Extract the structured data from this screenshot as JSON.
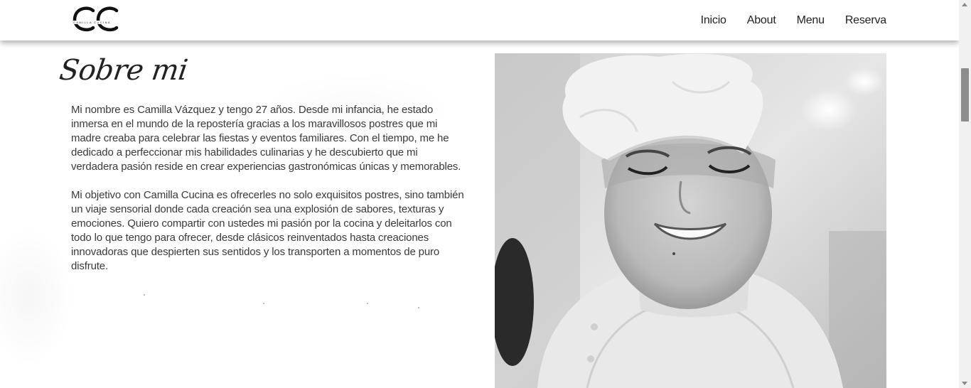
{
  "brand": {
    "logo_text": "CAMILLA CUCINA",
    "monogram": "CC"
  },
  "nav": {
    "items": [
      {
        "label": "Inicio"
      },
      {
        "label": "About"
      },
      {
        "label": "Menu"
      },
      {
        "label": "Reserva"
      }
    ]
  },
  "about": {
    "title": "Sobre mi",
    "paragraphs": [
      "Mi nombre es Camilla Vázquez y tengo 27 años. Desde mi infancia, he estado inmersa en el mundo de la repostería gracias a los maravillosos postres que mi madre creaba para celebrar las fiestas y eventos familiares. Con el tiempo, me he dedicado a perfeccionar mis habilidades culinarias y he descubierto que mi verdadera pasión reside en crear experiencias gastronómicas únicas y memorables.",
      "Mi objetivo con Camilla Cucina es ofrecerles no solo exquisitos postres, sino también un viaje sensorial donde cada creación sea una explosión de sabores, texturas y emociones. Quiero compartir con ustedes mi pasión por la cocina y deleitarlos con todo lo que tengo para ofrecer, desde clásicos reinventados hasta creaciones innovadoras que despierten sus sentidos y los transporten a momentos de puro disfrute."
    ]
  },
  "photo": {
    "subject": "chef-portrait"
  },
  "colors": {
    "text": "#3a3a3a",
    "nav_text": "#222222",
    "background": "#ffffff",
    "scroll_thumb": "#8c8c8c"
  }
}
